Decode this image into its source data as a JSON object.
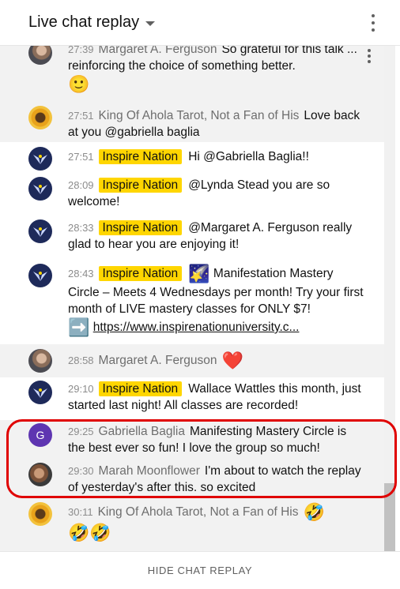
{
  "header": {
    "title": "Live chat replay"
  },
  "messages": [
    {
      "time": "27:39",
      "author": "Margaret A. Ferguson",
      "text": "So grateful for this talk ... reinforcing the choice of something better.",
      "emoji": "🙂"
    },
    {
      "time": "27:51",
      "author": "King Of Ahola Tarot, Not a Fan of His",
      "text": "Love back at you @gabriella baglia"
    },
    {
      "time": "27:51",
      "author": "Inspire Nation",
      "text": "Hi @Gabriella Baglia!!"
    },
    {
      "time": "28:09",
      "author": "Inspire Nation",
      "text": "@Lynda Stead you are so welcome!"
    },
    {
      "time": "28:33",
      "author": "Inspire Nation",
      "text": "@Margaret A. Ferguson really glad to hear you are enjoying it!"
    },
    {
      "time": "28:43",
      "author": "Inspire Nation",
      "emoji_before": "🌠",
      "text": "Manifestation Mastery Circle – Meets 4 Wednesdays per month! Try your first month of LIVE mastery classes for ONLY $7!",
      "emoji_after": "➡️",
      "link": "https://www.inspirenationuniversity.c..."
    },
    {
      "time": "28:58",
      "author": "Margaret A. Ferguson",
      "emoji": "❤️"
    },
    {
      "time": "29:10",
      "author": "Inspire Nation",
      "text": "Wallace Wattles this month, just started last night! All classes are recorded!"
    },
    {
      "time": "29:25",
      "author": "Gabriella Baglia",
      "avatar_letter": "G",
      "text": "Manifesting Mastery Circle is the best ever so fun! I love the group so much!"
    },
    {
      "time": "29:30",
      "author": "Marah Moonflower",
      "text": "I'm about to watch the replay of yesterday's after this. so excited"
    },
    {
      "time": "30:11",
      "author": "King Of Ahola Tarot, Not a Fan of His",
      "emoji": "🤣",
      "emoji_row": "🤣🤣"
    }
  ],
  "footer": {
    "label": "HIDE CHAT REPLAY"
  },
  "colors": {
    "owner_badge": "#ffd600",
    "highlight": "#e00000",
    "avatar_g": "#5e35b1"
  }
}
